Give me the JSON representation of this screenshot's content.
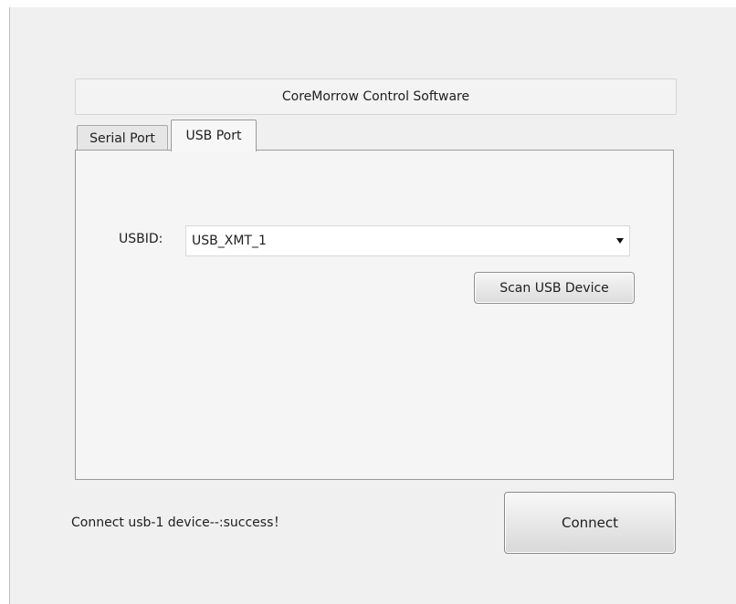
{
  "window": {
    "title": "CoreMorrow Control Software"
  },
  "tabs": [
    {
      "label": "Serial Port",
      "active": false
    },
    {
      "label": "USB Port",
      "active": true
    }
  ],
  "usb_panel": {
    "usbid_label": "USBID:",
    "usbid_selected": "USB_XMT_1",
    "scan_button_label": "Scan USB Device"
  },
  "status": {
    "message": "Connect usb-1 device--:success！"
  },
  "connect_button_label": "Connect"
}
